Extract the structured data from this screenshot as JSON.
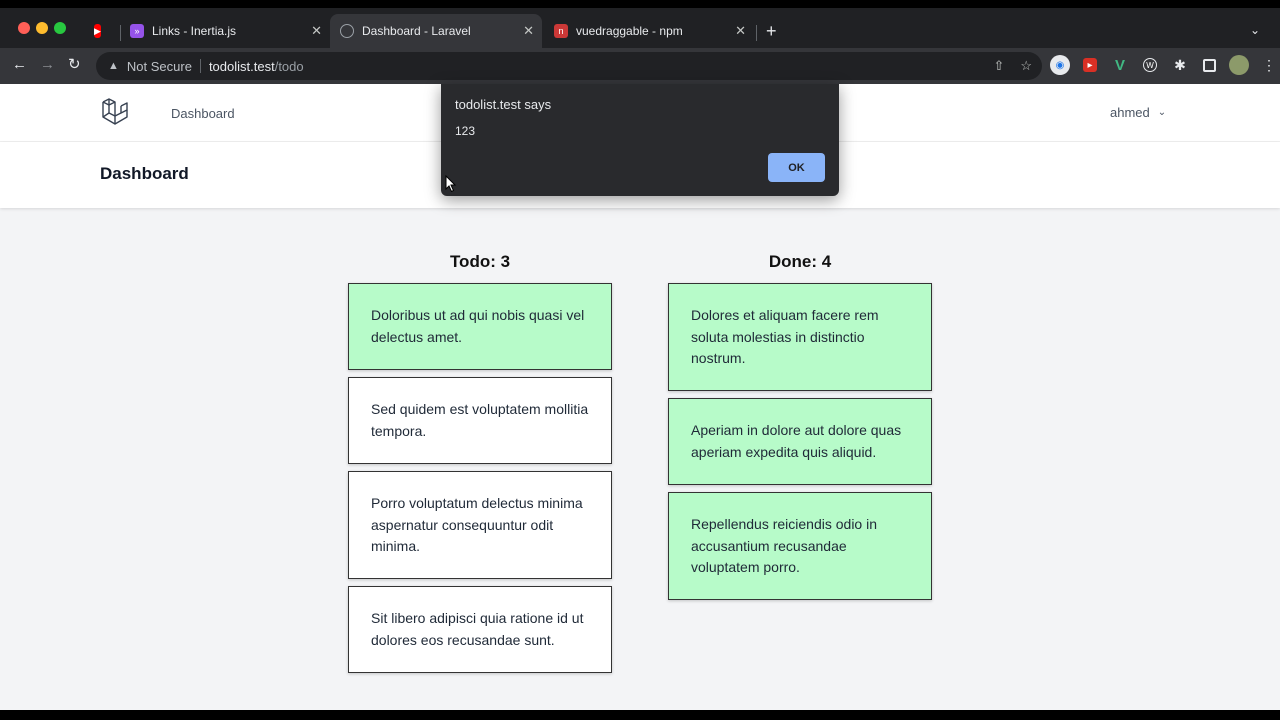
{
  "browser": {
    "tabs": [
      {
        "title": "",
        "favicon": "youtube-icon",
        "color": "#ff0000"
      },
      {
        "title": "Links - Inertia.js",
        "favicon": "inertia-icon",
        "color": "#9553e9"
      },
      {
        "title": "Dashboard - Laravel",
        "favicon": "globe-icon",
        "color": "#5f6368"
      },
      {
        "title": "vuedraggable - npm",
        "favicon": "npm-icon",
        "color": "#cb3837"
      }
    ],
    "tab_close": "✕",
    "new_tab": "+",
    "address": {
      "security_label": "Not Secure",
      "host": "todolist.test",
      "path": "/todo"
    }
  },
  "app": {
    "nav": {
      "dashboard_link": "Dashboard",
      "user_name": "ahmed"
    },
    "header_title": "Dashboard"
  },
  "board": {
    "todo": {
      "title": "Todo: 3",
      "cards": [
        {
          "text": "Doloribus ut ad qui nobis quasi vel delectus amet.",
          "style": "green"
        },
        {
          "text": "Sed quidem est voluptatem mollitia tempora.",
          "style": "white"
        },
        {
          "text": "Porro voluptatum delectus minima aspernatur consequuntur odit minima.",
          "style": "white"
        },
        {
          "text": "Sit libero adipisci quia ratione id ut dolores eos recusandae sunt.",
          "style": "white"
        }
      ]
    },
    "done": {
      "title": "Done: 4",
      "cards": [
        {
          "text": "Dolores et aliquam facere rem soluta molestias in distinctio nostrum.",
          "style": "green"
        },
        {
          "text": "Aperiam in dolore aut dolore quas aperiam expedita quis aliquid.",
          "style": "green"
        },
        {
          "text": "Repellendus reiciendis odio in accusantium recusandae voluptatem porro.",
          "style": "green"
        }
      ]
    }
  },
  "alert": {
    "title": "todolist.test says",
    "message": "123",
    "ok_label": "OK"
  },
  "colors": {
    "card_green": "#b7fbc9",
    "alert_button": "#8ab4f8",
    "page_bg": "#f3f4f6"
  }
}
